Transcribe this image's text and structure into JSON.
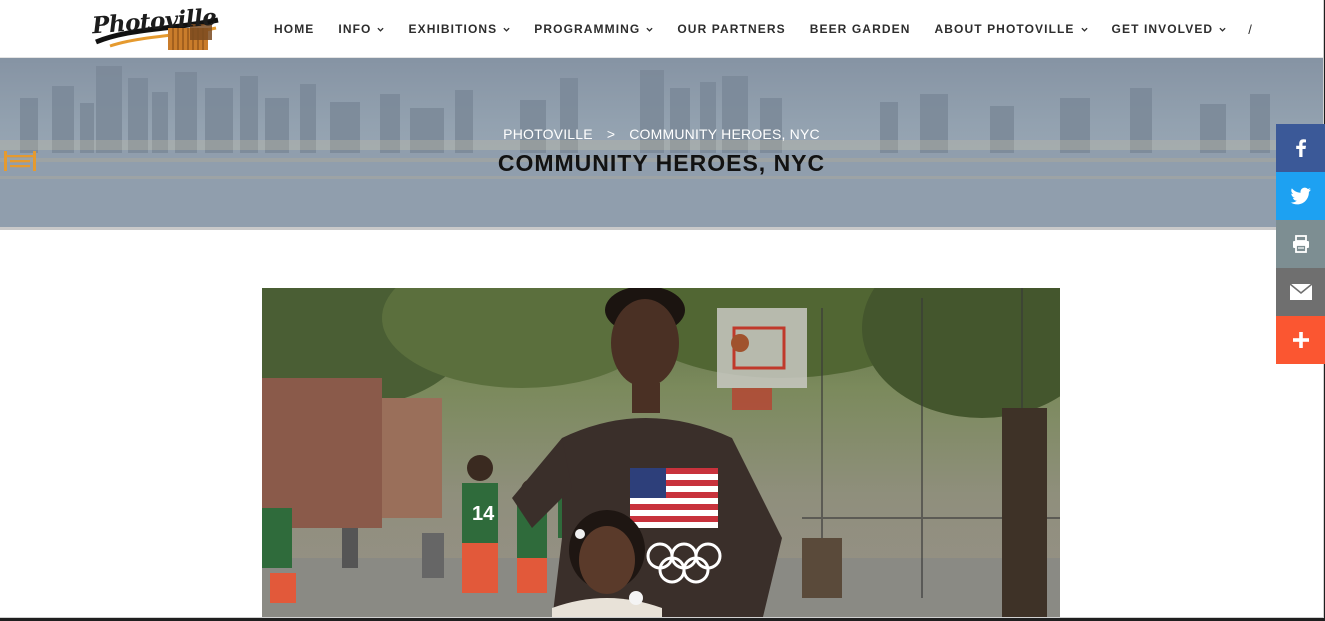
{
  "brand": {
    "logo_text": "Photoville"
  },
  "nav": {
    "items": [
      {
        "label": "HOME",
        "dropdown": false
      },
      {
        "label": "INFO",
        "dropdown": true
      },
      {
        "label": "EXHIBITIONS",
        "dropdown": true
      },
      {
        "label": "PROGRAMMING",
        "dropdown": true
      },
      {
        "label": "OUR PARTNERS",
        "dropdown": false
      },
      {
        "label": "BEER GARDEN",
        "dropdown": false
      },
      {
        "label": "ABOUT PHOTOVILLE",
        "dropdown": true
      },
      {
        "label": "GET INVOLVED",
        "dropdown": true
      }
    ],
    "trailing": "/"
  },
  "hero": {
    "breadcrumb": {
      "home": "PHOTOVILLE",
      "separator": ">",
      "current": "COMMUNITY HEROES, NYC"
    },
    "title": "COMMUNITY HEROES, NYC",
    "accent_color": "#e59a2f"
  },
  "share": {
    "buttons": [
      {
        "icon": "facebook-icon",
        "color": "#3b5998"
      },
      {
        "icon": "twitter-icon",
        "color": "#1da1f2"
      },
      {
        "icon": "print-icon",
        "color": "#7d8e92"
      },
      {
        "icon": "email-icon",
        "color": "#6f6f6f"
      },
      {
        "icon": "plus-icon",
        "color": "#fb5631"
      }
    ]
  },
  "photo": {
    "jersey_number": "14"
  }
}
